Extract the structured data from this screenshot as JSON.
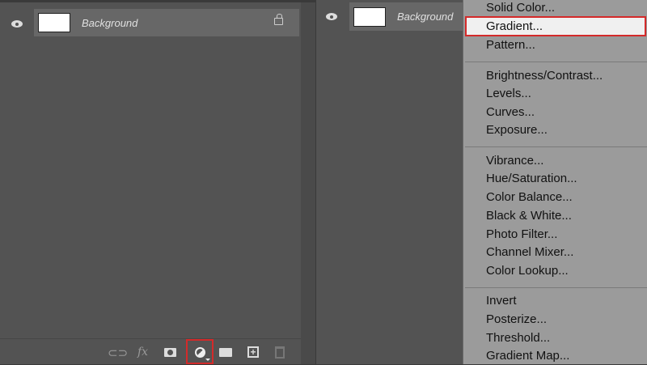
{
  "layers_panel": {
    "layer": {
      "name": "Background",
      "visible": true,
      "locked": true
    }
  },
  "toolbar": {
    "items": [
      {
        "icon": "link-icon"
      },
      {
        "icon": "fx-icon",
        "label": "fx"
      },
      {
        "icon": "mask-icon"
      },
      {
        "icon": "adjustment-layer-icon",
        "highlighted": true
      },
      {
        "icon": "folder-icon"
      },
      {
        "icon": "new-layer-icon"
      },
      {
        "icon": "trash-icon"
      }
    ]
  },
  "menu": {
    "groups": [
      [
        "Solid Color...",
        "Gradient...",
        "Pattern..."
      ],
      [
        "Brightness/Contrast...",
        "Levels...",
        "Curves...",
        "Exposure..."
      ],
      [
        "Vibrance...",
        "Hue/Saturation...",
        "Color Balance...",
        "Black & White...",
        "Photo Filter...",
        "Channel Mixer...",
        "Color Lookup..."
      ],
      [
        "Invert",
        "Posterize...",
        "Threshold...",
        "Gradient Map..."
      ]
    ],
    "highlighted": "Gradient..."
  },
  "colors": {
    "highlight_border": "#d42a2a",
    "panel": "#535353",
    "menu": "#9b9b9b"
  }
}
